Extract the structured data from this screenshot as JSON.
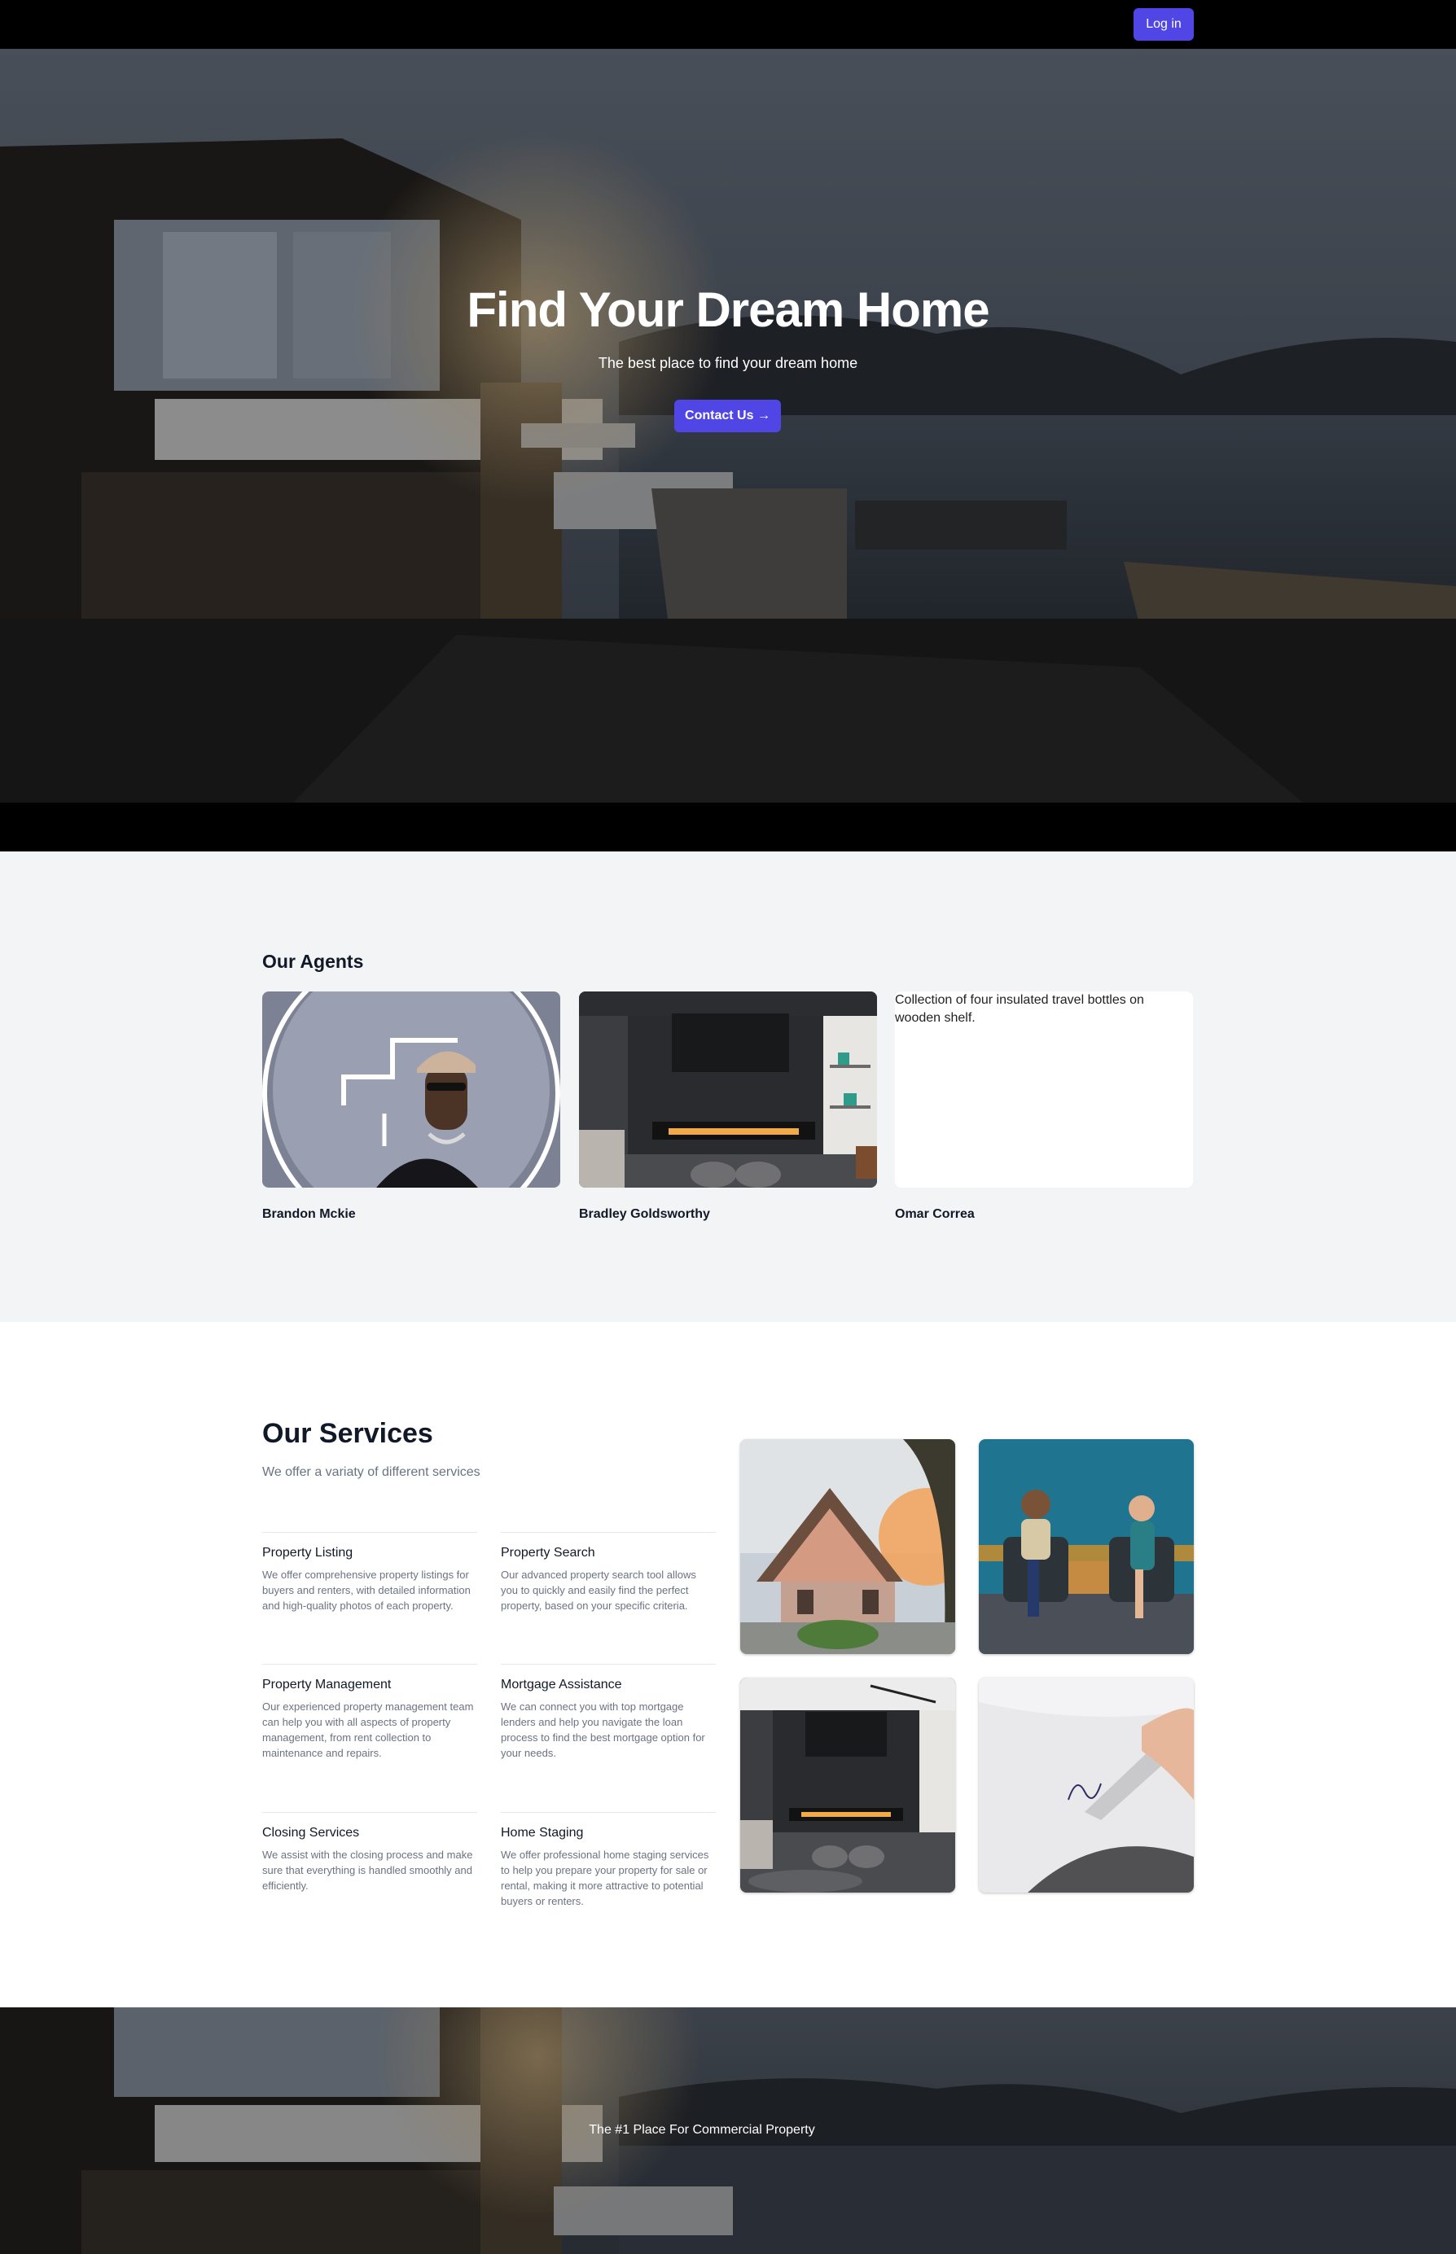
{
  "header": {
    "login_label": "Log in"
  },
  "hero": {
    "title": "Find Your Dream Home",
    "subtitle": "The best place to find your dream home",
    "cta_label": "Contact Us →"
  },
  "agents": {
    "title": "Our Agents",
    "items": [
      {
        "name": "Brandon Mckie"
      },
      {
        "name": "Bradley Goldsworthy"
      },
      {
        "name": "Omar Correa",
        "image_alt": "Collection of four insulated travel bottles on wooden shelf."
      }
    ]
  },
  "services": {
    "title": "Our Services",
    "subtitle": "We offer a variaty of different services",
    "items": [
      {
        "name": "Property Listing",
        "description": "We offer comprehensive property listings for buyers and renters, with detailed information and high-quality photos of each property."
      },
      {
        "name": "Property Search",
        "description": "Our advanced property search tool allows you to quickly and easily find the perfect property, based on your specific criteria."
      },
      {
        "name": "Property Management",
        "description": "Our experienced property management team can help you with all aspects of property management, from rent collection to maintenance and repairs."
      },
      {
        "name": "Mortgage Assistance",
        "description": "We can connect you with top mortgage lenders and help you navigate the loan process to find the best mortgage option for your needs."
      },
      {
        "name": "Closing Services",
        "description": "We assist with the closing process and make sure that everything is handled smoothly and efficiently."
      },
      {
        "name": "Home Staging",
        "description": "We offer professional home staging services to help you prepare your property for sale or rental, making it more attractive to potential buyers or renters."
      }
    ]
  },
  "footer": {
    "tagline": "The #1 Place For Commercial Property"
  },
  "colors": {
    "accent": "#4f46e5",
    "topbar": "#000000",
    "agents_bg": "#f3f4f6",
    "muted_text": "#6b7280"
  }
}
